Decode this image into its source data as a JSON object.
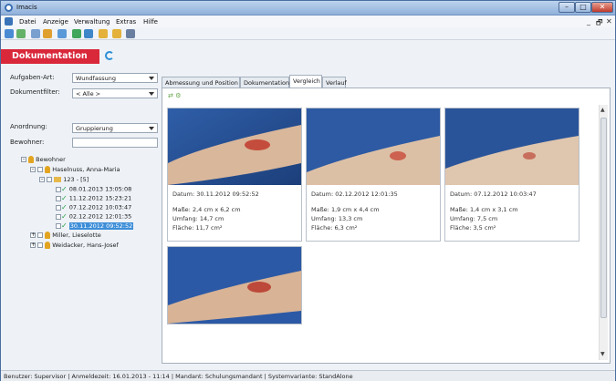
{
  "window": {
    "title": "Imacis"
  },
  "menu": {
    "items": [
      "Datei",
      "Anzeige",
      "Verwaltung",
      "Extras",
      "Hilfe"
    ]
  },
  "header": {
    "title": "Dokumentation"
  },
  "filters": {
    "aufgaben_label": "Aufgaben-Art:",
    "aufgaben_value": "Wundfassung",
    "dokfilter_label": "Dokumentfilter:",
    "dokfilter_value": "< Alle >",
    "anordnung_label": "Anordnung:",
    "anordnung_value": "Gruppierung",
    "bewohner_label": "Bewohner:"
  },
  "tree": {
    "root": "Bewohner",
    "resident1": "Haselnuss, Anna-Maria",
    "group": "123 - [5]",
    "dates": [
      "08.01.2013 13:05:08",
      "11.12.2012 15:23:21",
      "07.12.2012 10:03:47",
      "02.12.2012 12:01:35",
      "30.11.2012 09:52:52"
    ],
    "resident2": "Miller, Lieselotte",
    "resident3": "Weidacker, Hans-Josef"
  },
  "tabs": [
    "Abmessung und Position",
    "Dokumentation",
    "Vergleich",
    "Verlauf"
  ],
  "active_tab": "Vergleich",
  "cards": [
    {
      "datum": "Datum: 30.11.2012 09:52:52",
      "masse": "Maße: 2,4 cm x 6,2 cm",
      "umfang": "Umfang: 14,7 cm",
      "flaeche": "Fläche: 11,7 cm²"
    },
    {
      "datum": "Datum: 02.12.2012 12:01:35",
      "masse": "Maße: 1,9 cm x 4,4 cm",
      "umfang": "Umfang: 13,3 cm",
      "flaeche": "Fläche: 6,3 cm²"
    },
    {
      "datum": "Datum: 07.12.2012 10:03:47",
      "masse": "Maße: 1,4 cm x 3,1 cm",
      "umfang": "Umfang: 7,5 cm",
      "flaeche": "Fläche: 3,5 cm²"
    },
    {
      "datum": "",
      "masse": "",
      "umfang": "",
      "flaeche": ""
    }
  ],
  "status": {
    "text": "Benutzer: Supervisor  |  Anmeldezeit: 16.01.2013 - 11:14  |  Mandant: Schulungsmandant  |  Systemvariante: StandAlone"
  }
}
